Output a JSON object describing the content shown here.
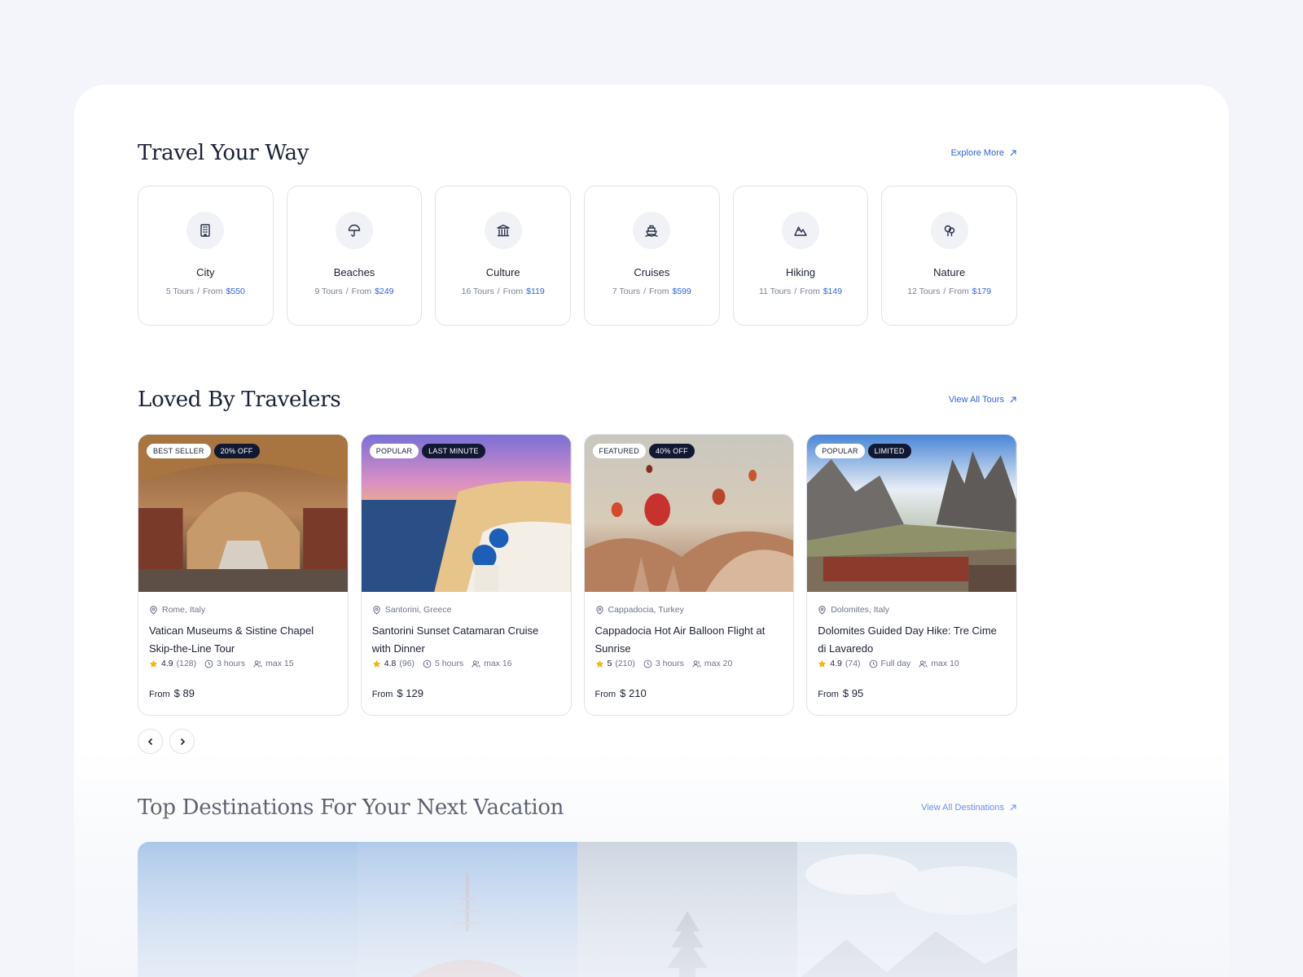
{
  "categories_section": {
    "title": "Travel Your Way",
    "link": "Explore More",
    "items": [
      {
        "name": "City",
        "tours": "5 Tours",
        "sep": "/",
        "from": "From",
        "price": "$550",
        "icon": "building-icon"
      },
      {
        "name": "Beaches",
        "tours": "9 Tours",
        "sep": "/",
        "from": "From",
        "price": "$249",
        "icon": "umbrella-icon"
      },
      {
        "name": "Culture",
        "tours": "16 Tours",
        "sep": "/",
        "from": "From",
        "price": "$119",
        "icon": "museum-icon"
      },
      {
        "name": "Cruises",
        "tours": "7 Tours",
        "sep": "/",
        "from": "From",
        "price": "$599",
        "icon": "ship-icon"
      },
      {
        "name": "Hiking",
        "tours": "11 Tours",
        "sep": "/",
        "from": "From",
        "price": "$149",
        "icon": "mountain-icon"
      },
      {
        "name": "Nature",
        "tours": "12 Tours",
        "sep": "/",
        "from": "From",
        "price": "$179",
        "icon": "trees-icon"
      }
    ]
  },
  "tours_section": {
    "title": "Loved By Travelers",
    "link": "View All Tours",
    "tours": [
      {
        "badges": [
          "BEST SELLER",
          "20% OFF"
        ],
        "location": "Rome, Italy",
        "title": "Vatican Museums & Sistine Chapel Skip-the-Line Tour",
        "rating": "4.9",
        "reviews": "(128)",
        "duration": "3 hours",
        "group": "max 15",
        "price_prefix": "From",
        "price": "$ 89"
      },
      {
        "badges": [
          "POPULAR",
          "LAST MINUTE"
        ],
        "location": "Santorini, Greece",
        "title": "Santorini Sunset Catamaran Cruise with Dinner",
        "rating": "4.8",
        "reviews": "(96)",
        "duration": "5 hours",
        "group": "max 16",
        "price_prefix": "From",
        "price": "$ 129"
      },
      {
        "badges": [
          "FEATURED",
          "40% OFF"
        ],
        "location": "Cappadocia, Turkey",
        "title": "Cappadocia Hot Air Balloon Flight at Sunrise",
        "rating": "5",
        "reviews": "(210)",
        "duration": "3 hours",
        "group": "max 20",
        "price_prefix": "From",
        "price": "$ 210"
      },
      {
        "badges": [
          "POPULAR",
          "LIMITED"
        ],
        "location": "Dolomites, Italy",
        "title": "Dolomites Guided Day Hike: Tre Cime di Lavaredo",
        "rating": "4.9",
        "reviews": "(74)",
        "duration": "Full day",
        "group": "max 10",
        "price_prefix": "From",
        "price": "$ 95"
      }
    ]
  },
  "destinations_section": {
    "title": "Top Destinations For Your Next Vacation",
    "link": "View All Destinations"
  },
  "colors": {
    "accent": "#2f63e0",
    "star": "#f5b50a",
    "badge_dark": "#101832"
  }
}
